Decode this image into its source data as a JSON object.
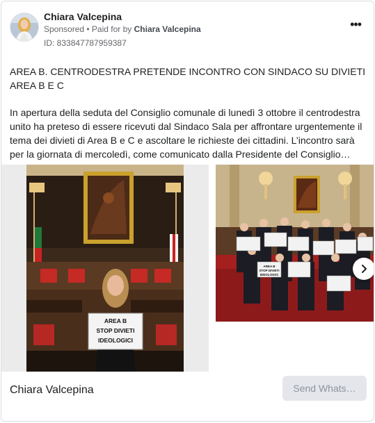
{
  "advertiser": {
    "name": "Chiara Valcepina",
    "sponsored_label": "Sponsored",
    "separator": " • ",
    "paid_for_by_label": "Paid for by ",
    "payer": "Chiara Valcepina",
    "ad_id": "ID: 833847787959387"
  },
  "post": {
    "title": "AREA B. CENTRODESTRA PRETENDE INCONTRO CON SINDACO SU DIVIETI AREA B E C",
    "body": "In apertura della seduta del Consiglio comunale di lunedì 3 ottobre il centrodestra unito ha preteso di essere ricevuti dal Sindaco Sala per affrontare urgentemente il tema dei divieti di Area B e C e ascoltare le richieste dei cittadini. L’incontro sarà per la giornata di mercoledì, come comunicato dalla Presidente del Consiglio…"
  },
  "carousel": {
    "slide1_sign": [
      "AREA B",
      "STOP DIVIETI",
      "IDEOLOGICI"
    ],
    "slide2_sign": [
      "AREA B",
      "STOP DIVIETI",
      "IDEOLOGICI"
    ]
  },
  "footer": {
    "page_name": "Chiara Valcepina",
    "cta_label": "Send Whats…"
  },
  "icons": {
    "more": "more-options-icon",
    "next": "chevron-right-icon"
  }
}
